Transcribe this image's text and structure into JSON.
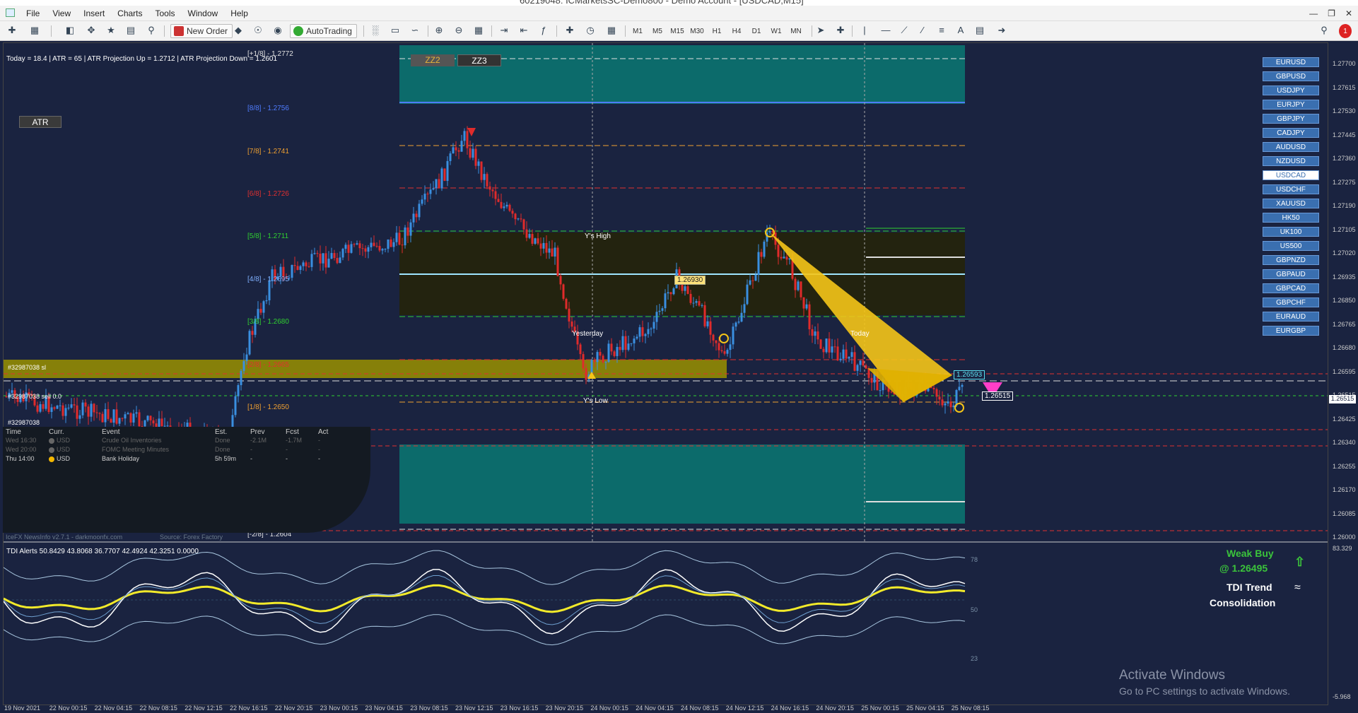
{
  "window": {
    "title": "60219048: ICMarketsSC-Demo800 - Demo Account - [USDCAD,M15]"
  },
  "menu": [
    "File",
    "View",
    "Insert",
    "Charts",
    "Tools",
    "Window",
    "Help"
  ],
  "toolbar": {
    "new_order": "New Order",
    "autotrading": "AutoTrading",
    "timeframes": [
      "M1",
      "M5",
      "M15",
      "M30",
      "H1",
      "H4",
      "D1",
      "W1",
      "MN"
    ]
  },
  "chart": {
    "info": "Today = 18.4   |   ATR = 65   |   ATR Projection Up = 1.2712   |   ATR Projection Down = 1.2601",
    "atr_button": "ATR",
    "zz_buttons": [
      "ZZ2",
      "ZZ3"
    ],
    "murrey": [
      {
        "label": "[+1/8] - 1.2772",
        "color": "#e0e0e0"
      },
      {
        "label": "[8/8] - 1.2756",
        "color": "#4f7cff"
      },
      {
        "label": "[7/8] - 1.2741",
        "color": "#f0a030"
      },
      {
        "label": "[6/8] - 1.2726",
        "color": "#e03030"
      },
      {
        "label": "[5/8] - 1.2711",
        "color": "#30d030"
      },
      {
        "label": "[4/8] - 1.2695",
        "color": "#7fb0ff"
      },
      {
        "label": "[3/8] - 1.2680",
        "color": "#30d030"
      },
      {
        "label": "[2/8] - 1.2665",
        "color": "#e03030"
      },
      {
        "label": "[1/8] - 1.2650",
        "color": "#f0a030"
      },
      {
        "label": "[-2/8] - 1.2604",
        "color": "#e0e0e0"
      }
    ],
    "yhigh": "Y's High",
    "ylow": "Y's Low",
    "yesterday": "Yesterday",
    "today": "Today",
    "price_tag_1": "1.26930",
    "price_tag_2": "1.26593",
    "price_tag_3": "1.26515",
    "current_price": "1.26515",
    "trade_labels": [
      "#32987038 sl",
      "#32987038 sell 0.0",
      "#32987038"
    ],
    "symbols": [
      "EURUSD",
      "GBPUSD",
      "USDJPY",
      "EURJPY",
      "GBPJPY",
      "CADJPY",
      "AUDUSD",
      "NZDUSD",
      "USDCAD",
      "USDCHF",
      "XAUUSD",
      "HK50",
      "UK100",
      "US500",
      "GBPNZD",
      "GBPAUD",
      "GBPCAD",
      "GBPCHF",
      "EURAUD",
      "EURGBP"
    ],
    "active_symbol": "USDCAD",
    "price_ticks": [
      "1.27700",
      "1.27615",
      "1.27530",
      "1.27445",
      "1.27360",
      "1.27275",
      "1.27190",
      "1.27105",
      "1.27020",
      "1.26935",
      "1.26850",
      "1.26765",
      "1.26680",
      "1.26595",
      "1.26515",
      "1.26425",
      "1.26340",
      "1.26255",
      "1.26170",
      "1.26085",
      "1.26000"
    ],
    "date_ticks": [
      "19 Nov 2021",
      "22 Nov 00:15",
      "22 Nov 04:15",
      "22 Nov 08:15",
      "22 Nov 12:15",
      "22 Nov 16:15",
      "22 Nov 20:15",
      "23 Nov 00:15",
      "23 Nov 04:15",
      "23 Nov 08:15",
      "23 Nov 12:15",
      "23 Nov 16:15",
      "23 Nov 20:15",
      "24 Nov 00:15",
      "24 Nov 04:15",
      "24 Nov 08:15",
      "24 Nov 12:15",
      "24 Nov 16:15",
      "24 Nov 20:15",
      "25 Nov 00:15",
      "25 Nov 04:15",
      "25 Nov 08:15"
    ]
  },
  "news": {
    "headers": [
      "Time",
      "Curr.",
      "Event",
      "Est.",
      "Prev",
      "Fcst",
      "Act"
    ],
    "rows": [
      {
        "time": "Wed 16:30",
        "curr": "USD",
        "event": "Crude Oil Inventories",
        "est": "Done",
        "prev": "-2.1M",
        "fcst": "-1.7M",
        "act": "-"
      },
      {
        "time": "Wed 20:00",
        "curr": "USD",
        "event": "FOMC Meeting Minutes",
        "est": "Done",
        "prev": "-",
        "fcst": "-",
        "act": "-"
      },
      {
        "time": "Thu 14:00",
        "curr": "USD",
        "event": "Bank Holiday",
        "est": "5h 59m",
        "prev": "-",
        "fcst": "-",
        "act": "-"
      }
    ],
    "footer_left": "IceFX NewsInfo v2.7.1  -  darkmoonfx.com",
    "footer_right": "Source: Forex Factory"
  },
  "tdi": {
    "header": "TDI Alerts  50.8429 43.8068 36.7707 42.4924 42.3251 0.0000",
    "signal_line1": "Weak Buy",
    "signal_line2": "@ 1.26495",
    "trend_line1": "TDI Trend",
    "trend_line2": "Consolidation",
    "levels": [
      "78",
      "50",
      "23"
    ],
    "top_tick": "83.329",
    "bottom_tick": "-5.968"
  },
  "watermark": {
    "line1": "Activate Windows",
    "line2": "Go to PC settings to activate Windows."
  },
  "colors": {
    "bg": "#1a2340",
    "bull": "#3a8fe0",
    "bear": "#e02b2b",
    "teal": "#0c6b6b",
    "olive": "#9a9000",
    "zone": "#23230f"
  }
}
